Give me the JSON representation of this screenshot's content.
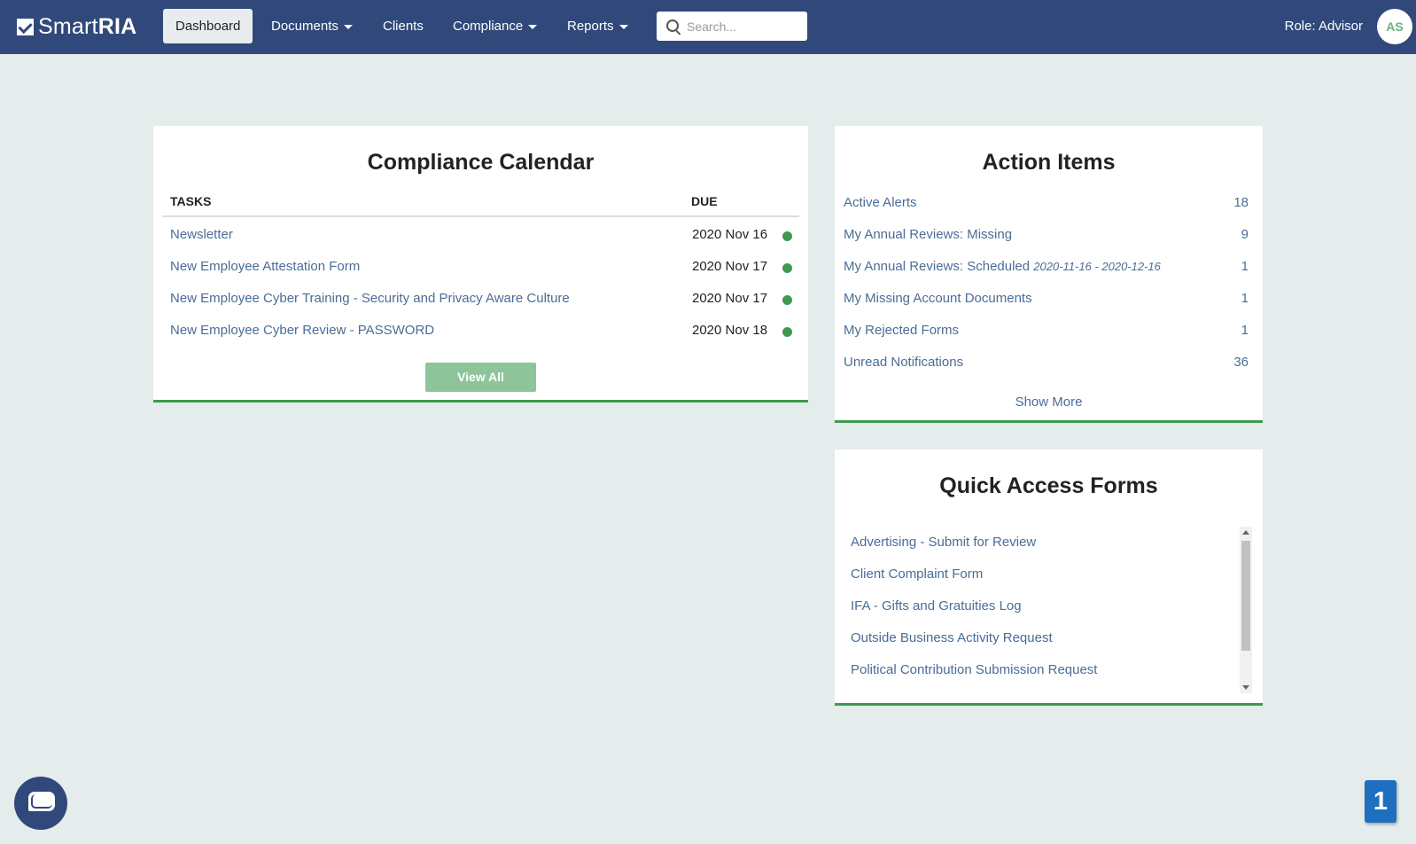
{
  "header": {
    "logo_light": "Smart",
    "logo_bold": "RIA",
    "nav": [
      {
        "label": "Dashboard"
      },
      {
        "label": "Documents"
      },
      {
        "label": "Clients"
      },
      {
        "label": "Compliance"
      },
      {
        "label": "Reports"
      }
    ],
    "search_placeholder": "Search...",
    "role": "Role: Advisor",
    "avatar_initials": "AS"
  },
  "compliance_calendar": {
    "title": "Compliance Calendar",
    "col_tasks": "TASKS",
    "col_due": "DUE",
    "rows": [
      {
        "task": "Newsletter",
        "due": "2020 Nov 16"
      },
      {
        "task": "New Employee Attestation Form",
        "due": "2020 Nov 17"
      },
      {
        "task": "New Employee Cyber Training - Security and Privacy Aware Culture",
        "due": "2020 Nov 17"
      },
      {
        "task": "New Employee Cyber Review - PASSWORD",
        "due": "2020 Nov 18"
      }
    ],
    "view_all": "View All",
    "status_color": "#3e9a4e"
  },
  "action_items": {
    "title": "Action Items",
    "items": [
      {
        "label": "Active Alerts",
        "count": "18"
      },
      {
        "label": "My Annual Reviews: Missing",
        "count": "9"
      },
      {
        "label": "My Annual Reviews: Scheduled",
        "range": "2020-11-16 - 2020-12-16",
        "count": "1"
      },
      {
        "label": "My Missing Account Documents",
        "count": "1"
      },
      {
        "label": "My Rejected Forms",
        "count": "1"
      },
      {
        "label": "Unread Notifications",
        "count": "36"
      }
    ],
    "show_more": "Show More"
  },
  "quick_access": {
    "title": "Quick Access Forms",
    "items": [
      "Advertising - Submit for Review",
      "Client Complaint Form",
      "IFA - Gifts and Gratuities Log",
      "Outside Business Activity Request",
      "Political Contribution Submission Request"
    ]
  },
  "notification_badge": "1",
  "colors": {
    "nav_bg": "#31497a",
    "page_bg": "#e4ecec",
    "accent_green": "#3e9a4e",
    "link": "#4a6d96"
  }
}
